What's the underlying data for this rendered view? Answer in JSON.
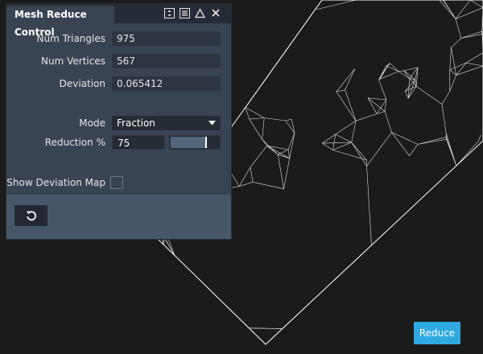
{
  "panel": {
    "title": "Mesh Reduce Control",
    "titlebar_icons": [
      "collapse-expand-icon",
      "menu-icon",
      "warning-icon",
      "close-icon"
    ],
    "num_triangles_label": "Num Triangles",
    "num_triangles_value": "975",
    "num_vertices_label": "Num Vertices",
    "num_vertices_value": "567",
    "deviation_label": "Deviation",
    "deviation_value": "0.065412",
    "mode_label": "Mode",
    "mode_value": "Fraction",
    "reduction_label": "Reduction %",
    "reduction_value": "75",
    "reduction_slider_fraction": 0.75,
    "show_deviation_map_label": "Show Deviation Map",
    "show_deviation_map_checked": false,
    "reset_icon": "reset-icon"
  },
  "reduce_button_label": "Reduce",
  "colors": {
    "background": "#1b1b1b",
    "panel": "#394452",
    "titlebar": "#262c35",
    "accent": "#2fa9e0",
    "wireframe": "#ffffff"
  }
}
